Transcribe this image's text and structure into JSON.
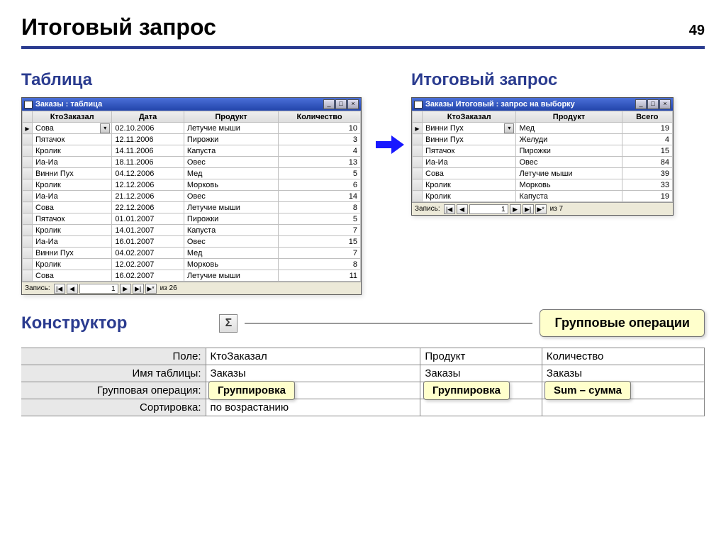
{
  "page_number": "49",
  "main_title": "Итоговый запрос",
  "sections": {
    "table_title": "Таблица",
    "query_title": "Итоговый запрос",
    "constructor_title": "Конструктор"
  },
  "table_window": {
    "title": "Заказы : таблица",
    "columns": [
      "КтоЗаказал",
      "Дата",
      "Продукт",
      "Количество"
    ],
    "rows": [
      {
        "who": "Сова",
        "date": "02.10.2006",
        "prod": "Летучие мыши",
        "qty": "10",
        "dropdown": true
      },
      {
        "who": "Пятачок",
        "date": "12.11.2006",
        "prod": "Пирожки",
        "qty": "3"
      },
      {
        "who": "Кролик",
        "date": "14.11.2006",
        "prod": "Капуста",
        "qty": "4"
      },
      {
        "who": "Иа-Иа",
        "date": "18.11.2006",
        "prod": "Овес",
        "qty": "13"
      },
      {
        "who": "Винни Пух",
        "date": "04.12.2006",
        "prod": "Мед",
        "qty": "5"
      },
      {
        "who": "Кролик",
        "date": "12.12.2006",
        "prod": "Морковь",
        "qty": "6"
      },
      {
        "who": "Иа-Иа",
        "date": "21.12.2006",
        "prod": "Овес",
        "qty": "14"
      },
      {
        "who": "Сова",
        "date": "22.12.2006",
        "prod": "Летучие мыши",
        "qty": "8"
      },
      {
        "who": "Пятачок",
        "date": "01.01.2007",
        "prod": "Пирожки",
        "qty": "5"
      },
      {
        "who": "Кролик",
        "date": "14.01.2007",
        "prod": "Капуста",
        "qty": "7"
      },
      {
        "who": "Иа-Иа",
        "date": "16.01.2007",
        "prod": "Овес",
        "qty": "15"
      },
      {
        "who": "Винни Пух",
        "date": "04.02.2007",
        "prod": "Мед",
        "qty": "7"
      },
      {
        "who": "Кролик",
        "date": "12.02.2007",
        "prod": "Морковь",
        "qty": "8"
      },
      {
        "who": "Сова",
        "date": "16.02.2007",
        "prod": "Летучие мыши",
        "qty": "11"
      }
    ],
    "record_label": "Запись:",
    "record_current": "1",
    "record_total": "из 26"
  },
  "query_window": {
    "title": "Заказы Итоговый : запрос на выборку",
    "columns": [
      "КтоЗаказал",
      "Продукт",
      "Всего"
    ],
    "rows": [
      {
        "who": "Винни Пух",
        "prod": "Мед",
        "total": "19",
        "dropdown": true
      },
      {
        "who": "Винни Пух",
        "prod": "Желуди",
        "total": "4"
      },
      {
        "who": "Пятачок",
        "prod": "Пирожки",
        "total": "15"
      },
      {
        "who": "Иа-Иа",
        "prod": "Овес",
        "total": "84"
      },
      {
        "who": "Сова",
        "prod": "Летучие мыши",
        "total": "39"
      },
      {
        "who": "Кролик",
        "prod": "Морковь",
        "total": "33"
      },
      {
        "who": "Кролик",
        "prod": "Капуста",
        "total": "19"
      }
    ],
    "record_label": "Запись:",
    "record_current": "1",
    "record_total": "из 7"
  },
  "sigma_label": "Σ",
  "group_ops_callout": "Групповые операции",
  "designer": {
    "labels": {
      "field": "Поле:",
      "table": "Имя таблицы:",
      "groupop": "Групповая операция:",
      "sort": "Сортировка:"
    },
    "cols": [
      {
        "field": "КтоЗаказал",
        "table": "Заказы",
        "groupop": "Группировка",
        "sort": "по возрастанию",
        "chip": "Группировка"
      },
      {
        "field": "Продукт",
        "table": "Заказы",
        "groupop": "Группировка",
        "sort": "",
        "chip": "Группировка"
      },
      {
        "field": "Количество",
        "table": "Заказы",
        "groupop": "Sum",
        "sort": "",
        "chip": "Sum – сумма"
      }
    ]
  }
}
